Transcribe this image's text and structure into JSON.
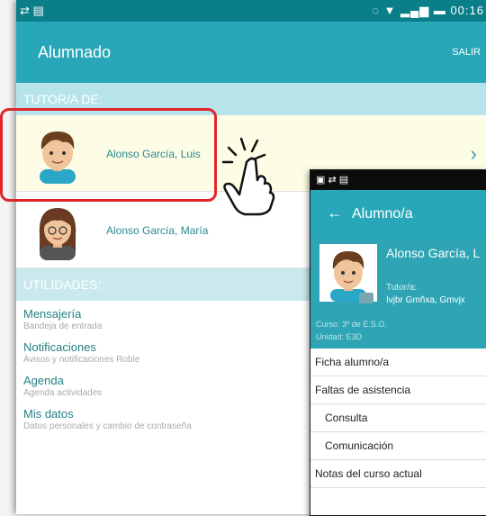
{
  "tablet": {
    "status": {
      "time": "00:16"
    },
    "appbar": {
      "title": "Alumnado",
      "action": "SALIR"
    },
    "section_tutor": "TUTOR/A DE:",
    "students": [
      {
        "name": "Alonso García, Luis"
      },
      {
        "name": "Alonso García, María"
      }
    ],
    "section_util": "UTILIDADES:",
    "utilities": [
      {
        "title": "Mensajería",
        "subtitle": "Bandeja de entrada"
      },
      {
        "title": "Notificaciones",
        "subtitle": "Avisos y notificaciones Roble"
      },
      {
        "title": "Agenda",
        "subtitle": "Agenda actividades"
      },
      {
        "title": "Mis datos",
        "subtitle": "Datos personales y cambio de contraseña"
      }
    ],
    "colors": {
      "primary": "#27a7b8",
      "status": "#0a7f8a",
      "highlight": "#e0262a"
    }
  },
  "phone": {
    "appbar": {
      "title": "Alumno/a"
    },
    "student_name": "Alonso García, L",
    "tutor_label": "Tutor/a:",
    "tutor_name": "Ivjbr Gmñxa, Gmvjx",
    "curso": "Curso: 3º de E.S.O.",
    "unidad": "Unidad: E3D",
    "menu": {
      "ficha": "Ficha alumno/a",
      "faltas": "Faltas de asistencia",
      "consulta": "Consulta",
      "comunicacion": "Comunicación",
      "notas": "Notas del curso actual"
    }
  }
}
